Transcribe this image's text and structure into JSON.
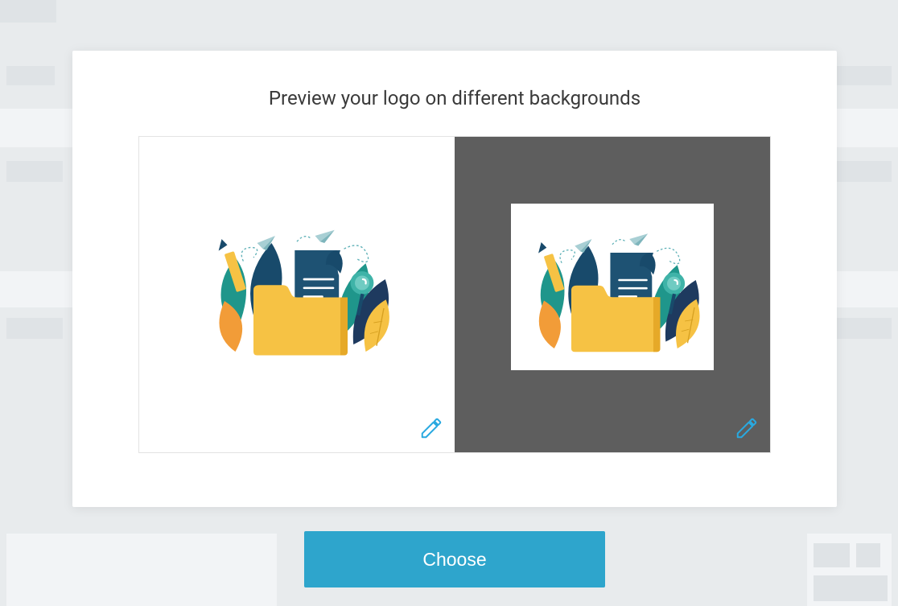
{
  "modal": {
    "title": "Preview your logo on different backgrounds"
  },
  "previews": {
    "light": {
      "background": "#ffffff",
      "edit_icon": "pencil-icon"
    },
    "dark": {
      "background": "#5e5e5e",
      "edit_icon": "pencil-icon"
    }
  },
  "button": {
    "choose_label": "Choose"
  },
  "colors": {
    "accent": "#2ea5cc",
    "edit_icon": "#29a9e0",
    "text": "#3a3a3a",
    "dark_bg": "#5e5e5e",
    "page_bg": "#e8ebed"
  }
}
